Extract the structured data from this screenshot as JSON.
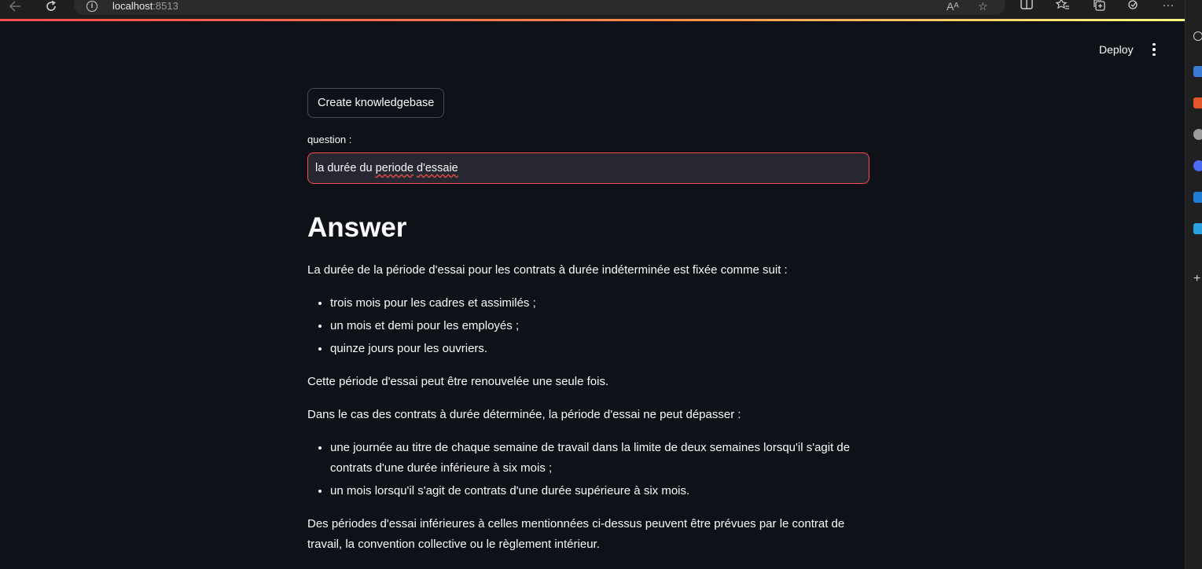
{
  "browser": {
    "url_host": "localhost",
    "url_port": ":8513",
    "read_aloud_icon": "Aᴬ",
    "icons": [
      "back-icon",
      "refresh-icon",
      "info-icon",
      "read-aloud-icon",
      "favorite-icon",
      "split-screen-icon",
      "favorites-icon",
      "collections-icon",
      "extensions-icon",
      "more-icon"
    ]
  },
  "header": {
    "deploy_label": "Deploy"
  },
  "main": {
    "create_kb_label": "Create knowledgebase",
    "question_label": "question :",
    "question_value_prefix": "la durée du ",
    "question_value_misspelled_1": "periode",
    "question_value_middle": " ",
    "question_value_misspelled_2": "d'essaie",
    "answer_title": "Answer",
    "answer": {
      "intro": "La durée de la période d'essai pour les contrats à durée indéterminée est fixée comme suit :",
      "list1": [
        "trois mois pour les cadres et assimilés ;",
        "un mois et demi pour les employés ;",
        "quinze jours pour les ouvriers."
      ],
      "renew": "Cette période d'essai peut être renouvelée une seule fois.",
      "cdd_intro": "Dans le cas des contrats à durée déterminée, la période d'essai ne peut dépasser :",
      "list2": [
        "une journée au titre de chaque semaine de travail dans la limite de deux semaines lorsqu'il s'agit de contrats d'une durée inférieure à six mois ;",
        "un mois lorsqu'il s'agit de contrats d'une durée supérieure à six mois."
      ],
      "closing": "Des périodes d'essai inférieures à celles mentionnées ci-dessus peuvent être prévues par le contrat de travail, la convention collective ou le règlement intérieur."
    }
  },
  "colors": {
    "background": "#0e1117",
    "accent": "#ff4b4b",
    "input_bg": "#262730",
    "text": "#fafafa"
  }
}
